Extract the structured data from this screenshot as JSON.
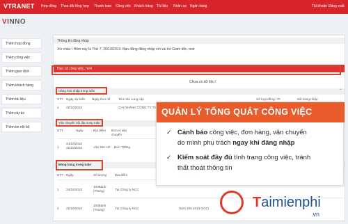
{
  "topnav": {
    "brand": "VTRANET",
    "items": [
      "Hợp đồng",
      "Theo dõi tổng hợp",
      "Thanh toán",
      "Công việc",
      "Khách hàng",
      "Tài liệu",
      "Nhân sự",
      "Ngân hàng"
    ],
    "right": [
      "Tài khoản",
      "Đăng xuất"
    ]
  },
  "logo": {
    "first": "V",
    "rest": "INNO"
  },
  "sidebar": {
    "items": [
      "Thêm hợp đồng",
      "Thêm công việc",
      "Thêm giao dịch",
      "Thêm khách hàng",
      "Thêm tài liệu",
      "Thêm dự án",
      "Thêm tin nội bộ"
    ]
  },
  "main": {
    "notice_header": "Thông tin đăng nhập",
    "notice_text": "Xin chào ! Hôm nay là Thứ 7, 26/10/2013. Bạn đăng đăng nhập với vai trò Giám đốc, test",
    "red_bar": "Hạn cả công việc, mới",
    "empty": "Chưa có dữ liệu !",
    "section1": {
      "title": "Hàng hóa nhập trong tuần",
      "headers": [
        "STT",
        "Ngày dự kiến",
        "Ngày thực tế",
        "Tên nhà cung cấp",
        "Số hợp đồng / PI",
        "Mã hàng nhập"
      ],
      "rows": [
        [
          "1",
          "22/10/2013",
          "",
          "CHI NHÁNH CÔNG TY TNHH...",
          "",
          ""
        ]
      ]
    },
    "section2": {
      "title": "Vận chuyển nội địa trong tuần",
      "headers": [
        "STT",
        "Ngày",
        "Địa điểm",
        "Đơn vị vận chuyển"
      ],
      "rows": [
        [
          "1",
          "24/10/2013 22/10/2013",
          "Văn bản HP",
          "Đức Thắng"
        ]
      ]
    },
    "section3": {
      "title": "Đóng hàng trong tuần",
      "headers": [
        "STT",
        "Ngày",
        "Số lượng",
        "Địa điểm",
        "Số hợp đồng"
      ],
      "rows": [
        [
          "1",
          "24/10/2013",
          "100Bảnh (Thùng)",
          "Tại Công ty NCC",
          ""
        ],
        [
          "2",
          "22/10/2013",
          "100Bảnh (Thùng)",
          "Tại Công ty NCC",
          "SUN.105.1013-GCCI"
        ]
      ]
    }
  },
  "overlay": {
    "title": "QUẢN LÝ TỔNG QUÁT CÔNG VIỆC",
    "point1": {
      "bold1": "Cảnh báo",
      "text1": " công việc, đơn hàng, vận chuyển",
      "text2": "do mình phụ trách ",
      "bold2": "ngay khi đăng nhập"
    },
    "point2": {
      "bold1": "Kiểm soát đầy đủ",
      "text1": " tình trạng công việc, tránh",
      "text2": "thất thoát thông tin"
    }
  },
  "watermark": {
    "text": "aimienphi",
    "sub": ".vn"
  },
  "colors": {
    "nav": "#d7252b",
    "overlay_head": "#e95b2b",
    "watermark_red": "#e0392b",
    "watermark_blue": "#1f4f90"
  }
}
